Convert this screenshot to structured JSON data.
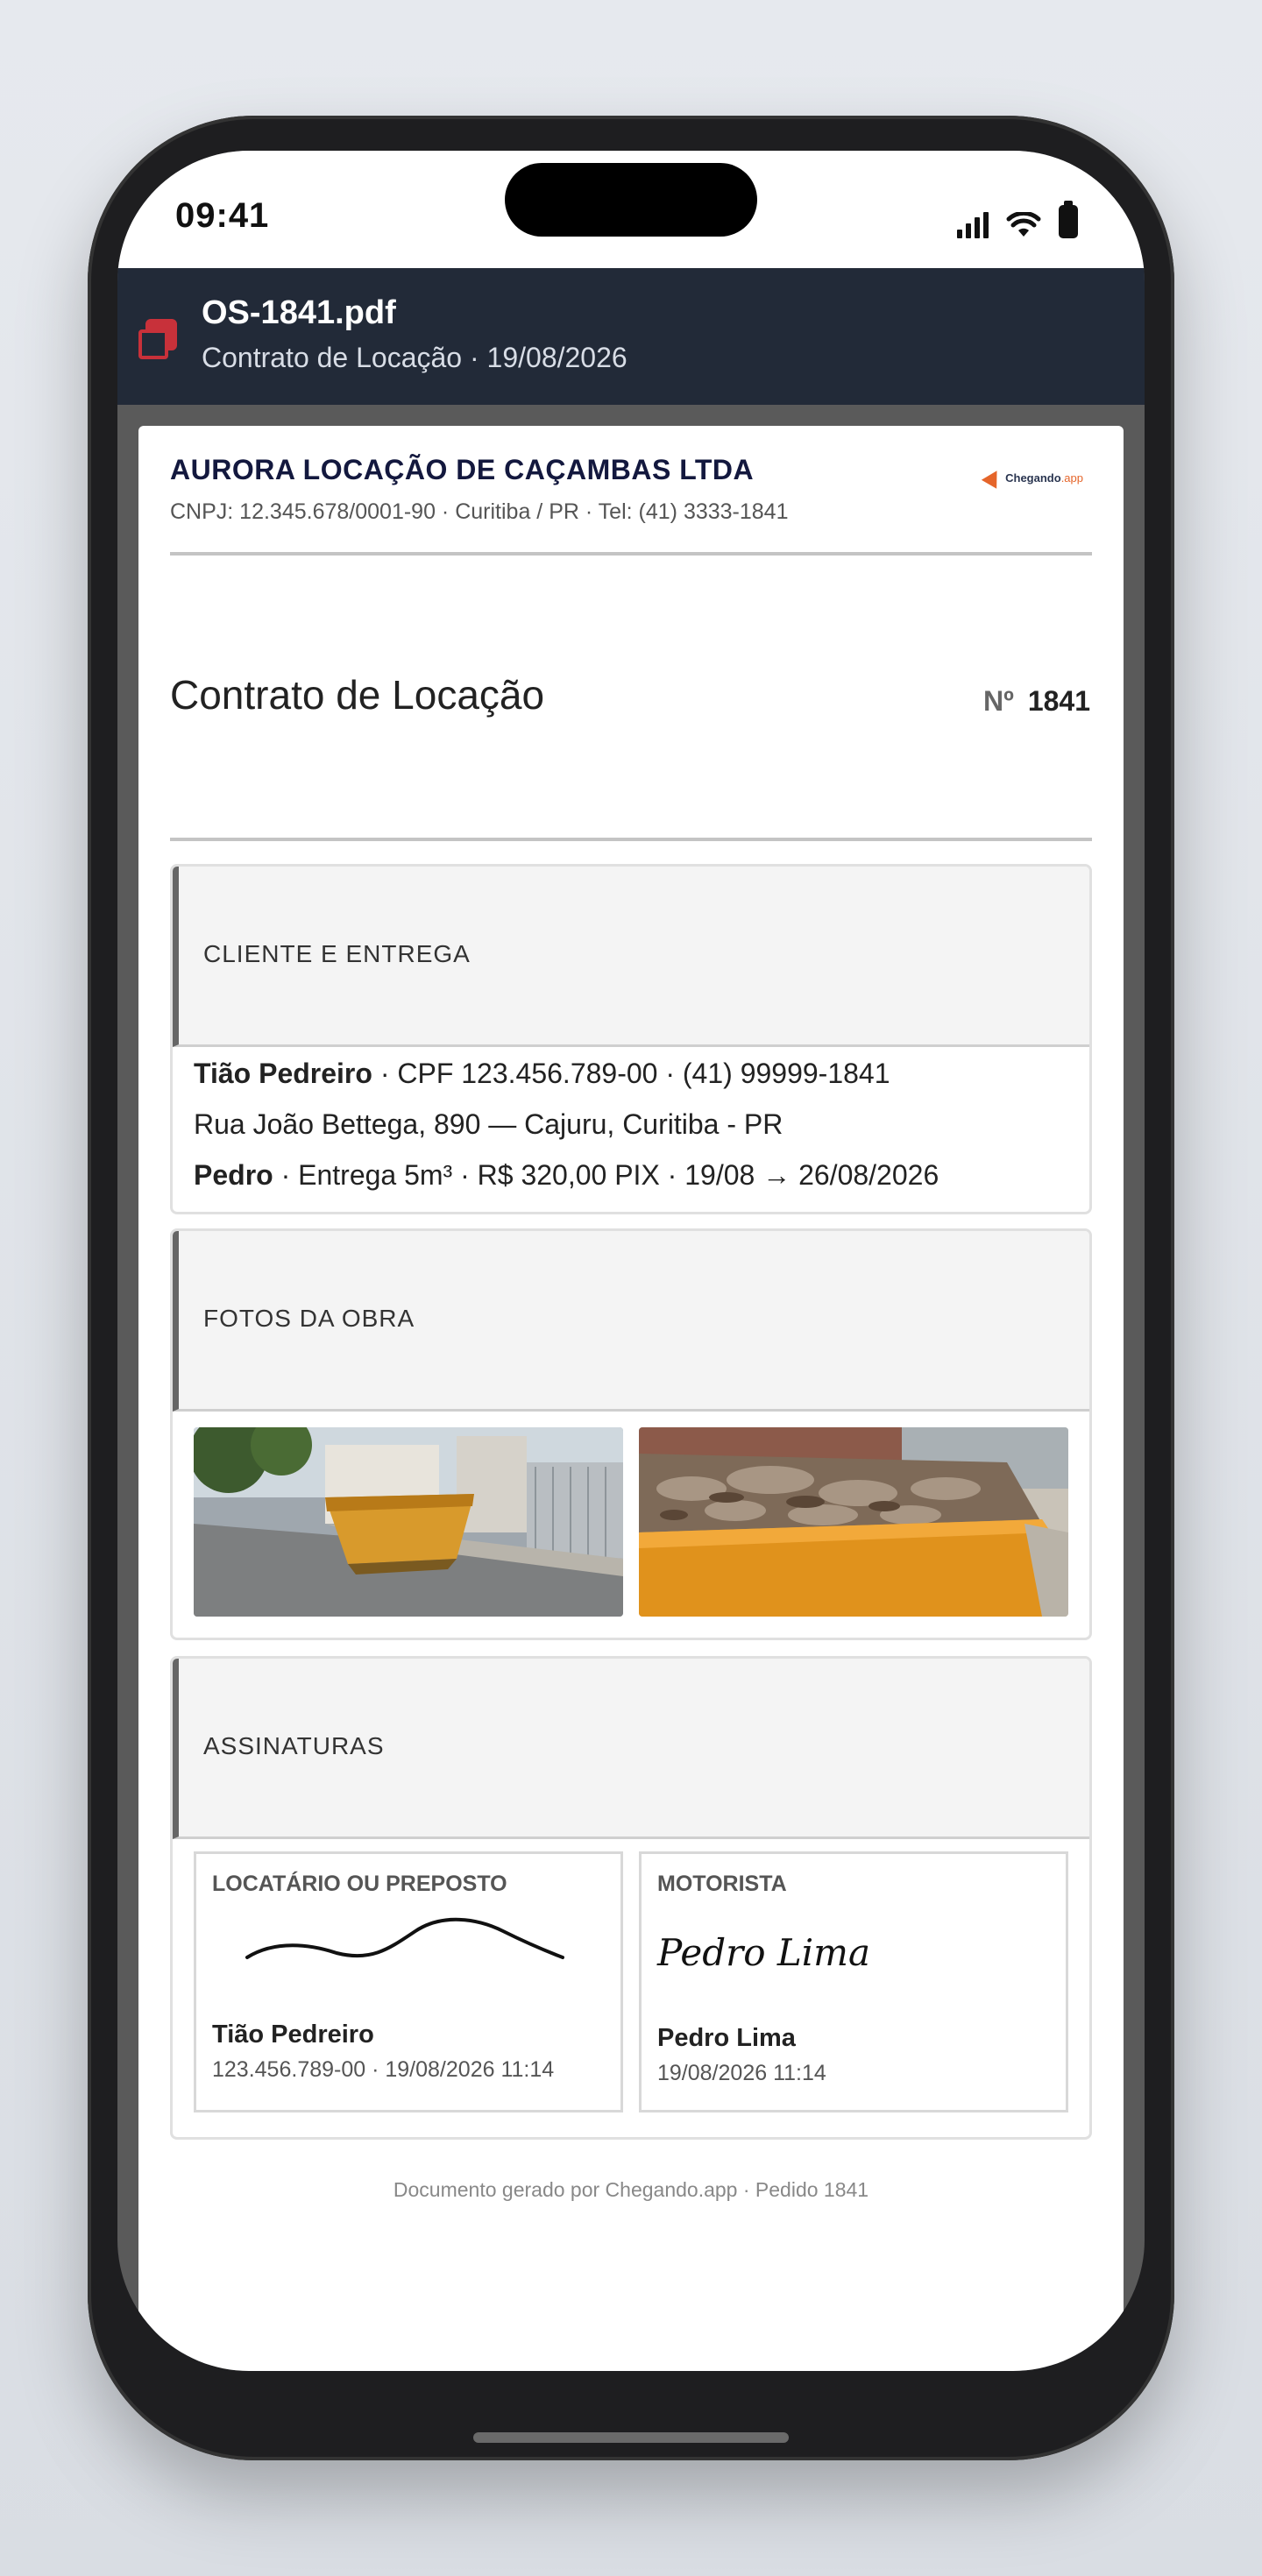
{
  "status_bar": {
    "time": "09:41"
  },
  "pdf_viewer": {
    "file_name": "OS-1841.pdf",
    "subtitle": "Contrato de Locação · 19/08/2026"
  },
  "company": {
    "name": "AURORA LOCAÇÃO DE CAÇAMBAS LTDA",
    "info": "CNPJ: 12.345.678/0001-90 · Curitiba / PR · Tel: (41) 3333-1841",
    "logo_text": "Chegando",
    "logo_suffix": ".app"
  },
  "document": {
    "title": "Contrato de Locação",
    "number_label": "Nº",
    "number": "1841"
  },
  "client_section": {
    "heading": "CLIENTE E ENTREGA",
    "client_name": "Tião Pedreiro",
    "client_details": " · CPF 123.456.789-00 · (41) 99999-1841",
    "address": "Rua João Bettega, 890 — Cajuru, Curitiba - PR",
    "driver": "Pedro",
    "delivery_details": " · Entrega 5m³ · R$ 320,00 PIX · 19/08 → 26/08/2026"
  },
  "photos_section": {
    "heading": "FOTOS DA OBRA"
  },
  "signatures_section": {
    "heading": "ASSINATURAS",
    "tenant": {
      "label": "LOCATÁRIO OU PREPOSTO",
      "name": "Tião Pedreiro",
      "meta": "123.456.789-00 · 19/08/2026 11:14"
    },
    "driver": {
      "label": "MOTORISTA",
      "script": "Pedro Lima",
      "name": "Pedro Lima",
      "meta": "19/08/2026 11:14"
    }
  },
  "footer": "Documento gerado por Chegando.app · Pedido 1841"
}
